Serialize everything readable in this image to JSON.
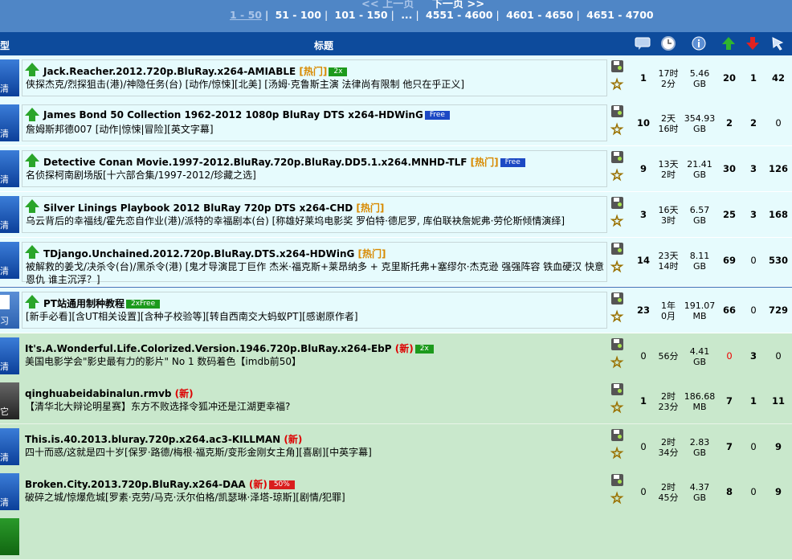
{
  "pager": {
    "prev": "<< 上一页",
    "next": "下一页 >>",
    "pages": [
      "1 - 50",
      "51 - 100",
      "101 - 150",
      "...",
      "4551 - 4600",
      "4601 - 4650",
      "4651 - 4700"
    ]
  },
  "header": {
    "type_label": "型",
    "title_label": "标题",
    "icons": [
      "comments-icon",
      "time-icon",
      "info-icon",
      "seeders-icon",
      "leechers-icon",
      "completed-icon"
    ]
  },
  "torrents": [
    {
      "sticky": true,
      "type": "清",
      "name": "Jack.Reacher.2012.720p.BluRay.x264-AMIABLE",
      "tag": "[热门]",
      "badge": "2x",
      "sub": "侠探杰克/烈探狙击(港)/神隐任务(台) [动作/惊悚][北美] [汤姆·克鲁斯主演 法律尚有限制 他只在乎正义]",
      "comments": "1",
      "time": "17时\n2分",
      "size": "5.46\nGB",
      "seeders": "20",
      "leechers": "1",
      "completed": "42"
    },
    {
      "sticky": true,
      "type": "清",
      "name": "James Bond 50 Collection 1962-2012 1080p BluRay DTS x264-HDWinG",
      "tag": "",
      "badge": "Free",
      "sub": "詹姆斯邦德007 [动作|惊悚|冒险][英文字幕]",
      "comments": "10",
      "time": "2天\n16时",
      "size": "354.93\nGB",
      "seeders": "2",
      "leechers": "2",
      "completed": "0"
    },
    {
      "sticky": true,
      "type": "清",
      "name": "Detective Conan Movie.1997-2012.BluRay.720p.BluRay.DD5.1.x264.MNHD-TLF",
      "tag": "[热门]",
      "badge": "Free",
      "sub": "名侦探柯南剧场版[十六部合集/1997-2012/珍藏之选]",
      "comments": "9",
      "time": "13天\n2时",
      "size": "21.41\nGB",
      "seeders": "30",
      "leechers": "3",
      "completed": "126"
    },
    {
      "sticky": true,
      "type": "清",
      "name": "Silver Linings Playbook 2012 BluRay 720p DTS x264-CHD",
      "tag": "[热门]",
      "badge": "",
      "sub": "乌云背后的幸福线/霍先恋自作业(港)/派特的幸福剧本(台) [称雄好莱坞电影奖 罗伯特·德尼罗, 库伯联袂詹妮弗·劳伦斯倾情演绎]",
      "comments": "3",
      "time": "16天\n3时",
      "size": "6.57\nGB",
      "seeders": "25",
      "leechers": "3",
      "completed": "168"
    },
    {
      "sticky": true,
      "type": "清",
      "name": "TDjango.Unchained.2012.720p.BluRay.DTS.x264-HDWinG",
      "tag": "[热门]",
      "badge": "",
      "sub": "被解救的姜戈/决杀令(台)/黑杀令(港) [鬼才导演昆丁巨作 杰米·福克斯+莱昂纳多 + 克里斯托弗+塞缪尔·杰克逊 强强阵容 铁血硬汉 快意恩仇 谁主沉浮？]",
      "comments": "14",
      "time": "23天\n14时",
      "size": "8.11\nGB",
      "seeders": "69",
      "leechers": "0",
      "completed": "530"
    },
    {
      "sticky": true,
      "type": "习",
      "doc": true,
      "name": "PT站通用制种教程",
      "tag": "",
      "badge": "2xFree",
      "sub": "[新手必看][含UT相关设置][含种子校验等][转自西南交大蚂蚁PT][感谢原作者]",
      "comments": "23",
      "time": "1年\n0月",
      "size": "191.07\nMB",
      "seeders": "66",
      "leechers": "0",
      "completed": "729"
    },
    {
      "sticky": false,
      "type": "清",
      "name": "It's.A.Wonderful.Life.Colorized.Version.1946.720p.BluRay.x264-EbP",
      "tag": "(新)",
      "badge": "2x",
      "sub": "美国电影学会\"影史最有力的影片\" No 1 数码着色【imdb前50】",
      "comments": "0",
      "time": "56分",
      "size": "4.41\nGB",
      "seeders": "0",
      "leechers": "3",
      "completed": "0",
      "seed_red": true
    },
    {
      "sticky": false,
      "type": "它",
      "other": true,
      "name": "qinghuabeidabinalun.rmvb",
      "tag": "(新)",
      "badge": "",
      "sub": "【清华北大辩论明星赛】东方不败选择令狐冲还是江湖更幸福?",
      "comments": "1",
      "time": "2时\n23分",
      "size": "186.68\nMB",
      "seeders": "7",
      "leechers": "1",
      "completed": "11"
    },
    {
      "sticky": false,
      "type": "清",
      "name": "This.is.40.2013.bluray.720p.x264.ac3-KILLMAN",
      "tag": "(新)",
      "badge": "",
      "sub": "四十而惑/这就是四十岁[保罗·路德/梅根·福克斯/变形金刚女主角][喜剧][中英字幕]",
      "comments": "0",
      "time": "2时\n34分",
      "size": "2.83\nGB",
      "seeders": "7",
      "leechers": "0",
      "completed": "9"
    },
    {
      "sticky": false,
      "type": "清",
      "name": "Broken.City.2013.720p.BluRay.x264-DAA",
      "tag": "(新)",
      "badge": "50%",
      "sub": "破碎之城/惊爆危城[罗素·克劳/马克·沃尔伯格/凯瑟琳·泽塔-琼斯][剧情/犯罪]",
      "comments": "0",
      "time": "2时\n45分",
      "size": "4.37\nGB",
      "seeders": "8",
      "leechers": "0",
      "completed": "9"
    }
  ],
  "colors": {
    "sticky_bg": "#e6fbfd",
    "normal_bg": "#c9e8cc",
    "header_bg": "#0d4b9c",
    "hot": "#d88a00",
    "new": "#dd0000"
  }
}
